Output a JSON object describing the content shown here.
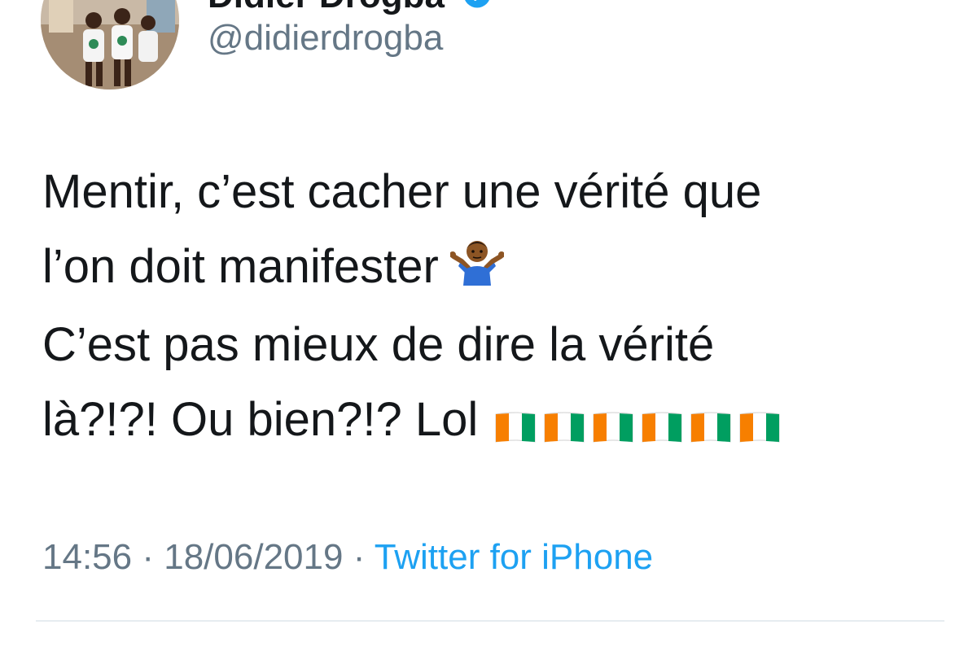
{
  "author": {
    "display_name": "Didier Drogba",
    "handle": "@didierdrogba",
    "verified": true
  },
  "tweet": {
    "lines": [
      "Mentir, c’est cacher une vérité que",
      "l’on doit manifester",
      "C’est pas mieux de dire la vérité",
      "là?!?! Ou bien?!? Lol"
    ],
    "emoji_after_line_2": "person-shrugging-emoji",
    "flag_emoji": "cote-divoire-flag",
    "flag_count": 6
  },
  "meta": {
    "time": "14:56",
    "separator": "·",
    "date": "18/06/2019",
    "source": "Twitter for iPhone"
  },
  "colors": {
    "text": "#14171a",
    "secondary": "#657786",
    "link": "#1da1f2",
    "flag_orange": "#f77f00",
    "flag_white": "#ffffff",
    "flag_green": "#009e60"
  }
}
